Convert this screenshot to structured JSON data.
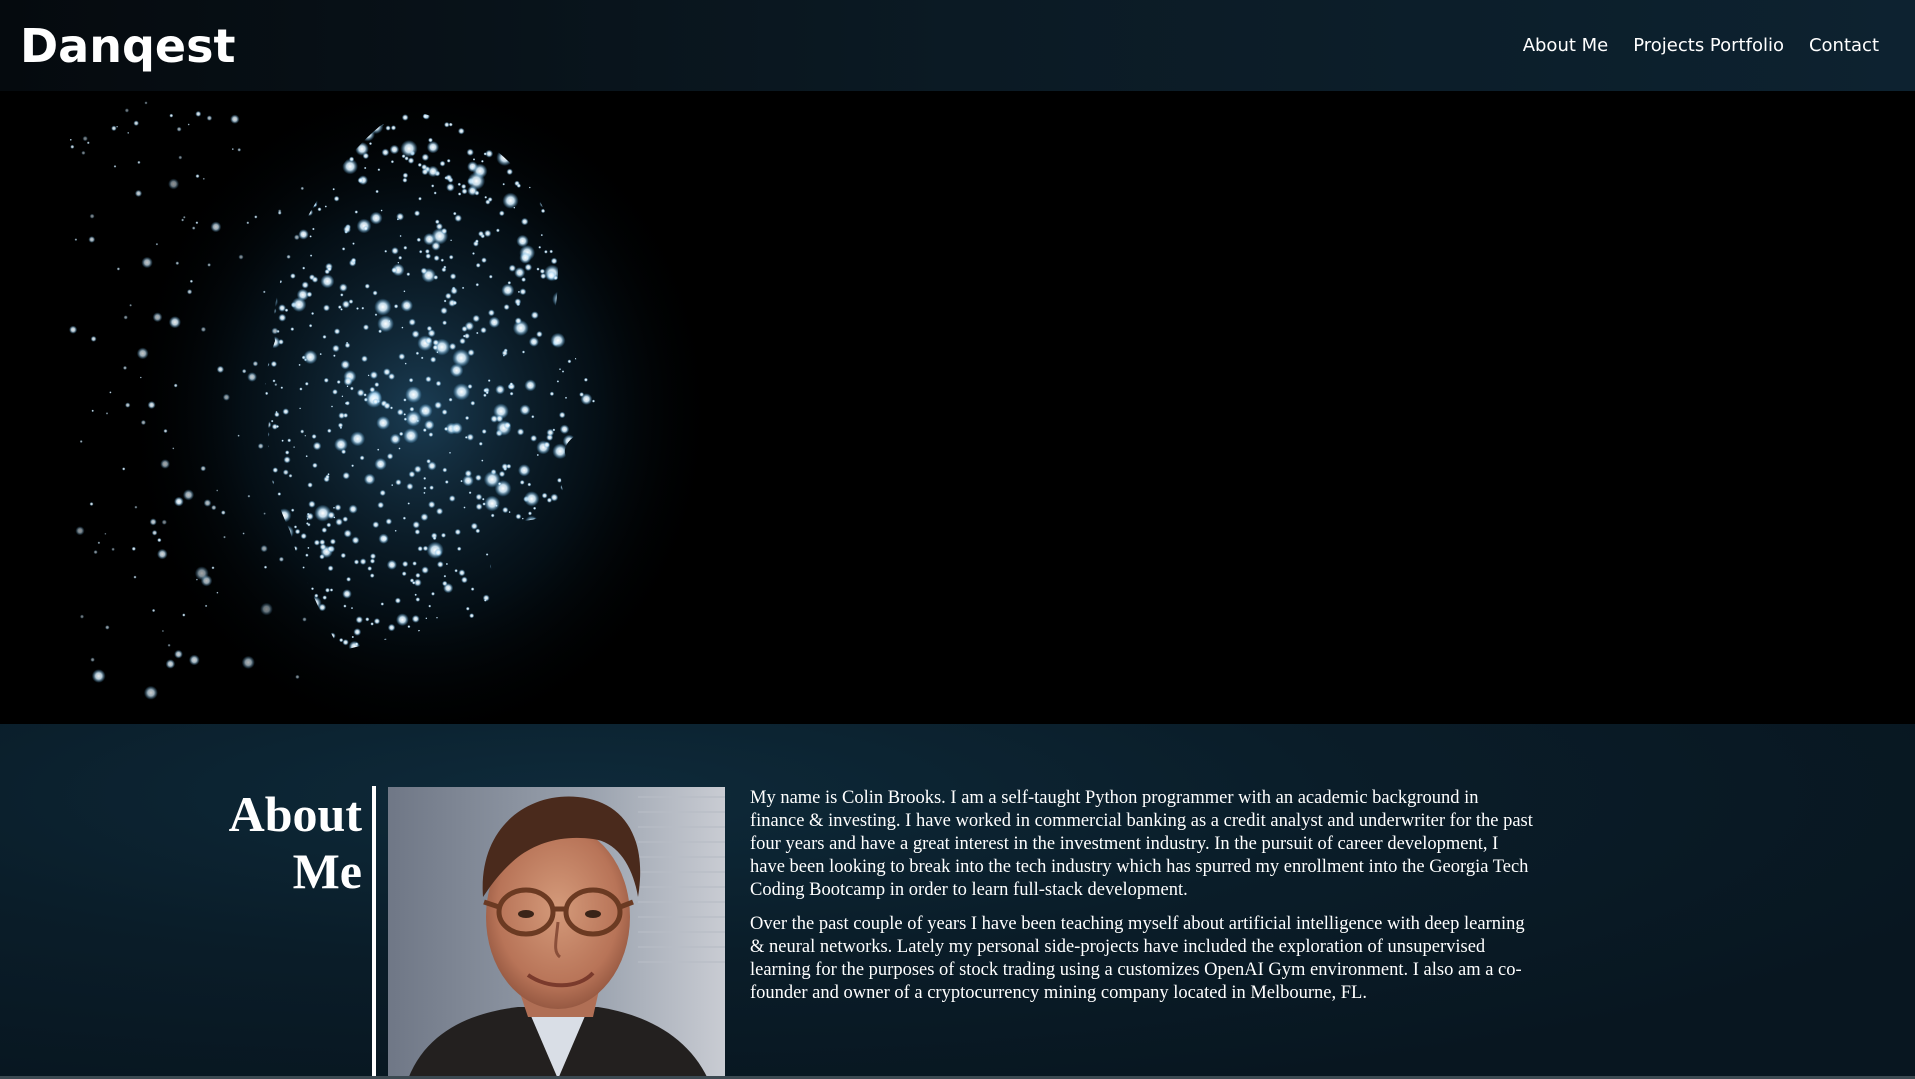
{
  "header": {
    "brand": "Danqest",
    "nav": [
      {
        "label": "About Me"
      },
      {
        "label": "Projects Portfolio"
      },
      {
        "label": "Contact"
      }
    ]
  },
  "hero": {
    "image": "particle-face-image",
    "background_color": "#000000",
    "particle_color": "#bfe6ff"
  },
  "about": {
    "heading_line1": "About",
    "heading_line2": "Me",
    "portrait": "portrait-photo",
    "paragraphs": [
      "My name is Colin Brooks. I am a self-taught Python programmer with an academic background in finance & investing. I have worked in commercial banking as a credit analyst and underwriter for the past four years and have a great interest in the investment industry. In the pursuit of career development, I have been looking to break into the tech industry which has spurred my enrollment into the Georgia Tech Coding Bootcamp in order to learn full-stack development.",
      "Over the past couple of years I have been teaching myself about artificial intelligence with deep learning & neural networks. Lately my personal side-projects have included the exploration of unsupervised learning for the purposes of stock trading using a customizes OpenAI Gym environment. I also am a co-founder and owner of a cryptocurrency mining company located in Melbourne, FL."
    ]
  }
}
